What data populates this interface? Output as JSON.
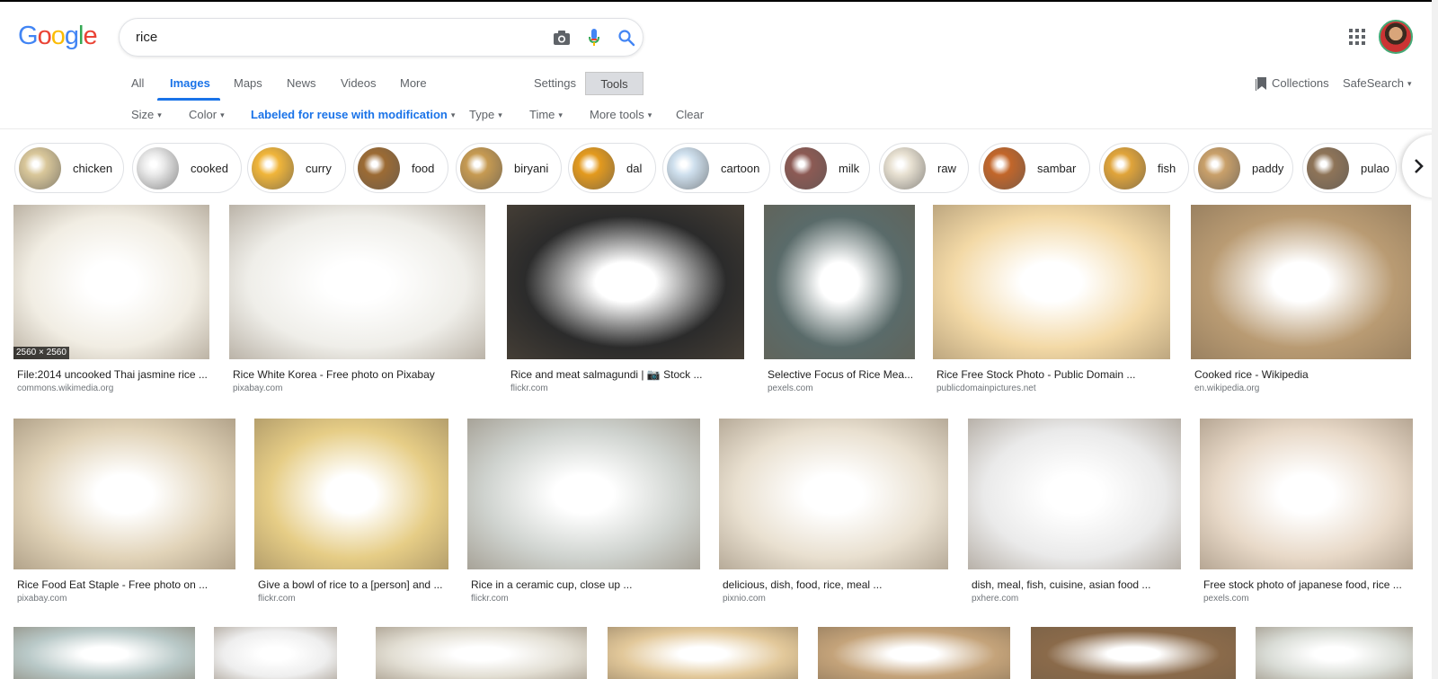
{
  "search": {
    "query": "rice"
  },
  "logo": {
    "letters": [
      "G",
      "o",
      "o",
      "g",
      "l",
      "e"
    ],
    "colors": [
      "#4285f4",
      "#ea4335",
      "#fbbc05",
      "#4285f4",
      "#34a853",
      "#ea4335"
    ]
  },
  "nav": {
    "tabs": [
      {
        "label": "All"
      },
      {
        "label": "Images"
      },
      {
        "label": "Maps"
      },
      {
        "label": "News"
      },
      {
        "label": "Videos"
      },
      {
        "label": "More"
      }
    ],
    "settings": "Settings",
    "tools": "Tools",
    "collections": "Collections",
    "safesearch": "SafeSearch"
  },
  "filters": {
    "size": "Size",
    "color": "Color",
    "usage": "Labeled for reuse with modification",
    "type": "Type",
    "time": "Time",
    "more_tools": "More tools",
    "clear": "Clear"
  },
  "chips": [
    {
      "label": "chicken",
      "color": "#d9c79a"
    },
    {
      "label": "cooked",
      "color": "#e9e9e9"
    },
    {
      "label": "curry",
      "color": "#f0b53a"
    },
    {
      "label": "food",
      "color": "#9c6b34"
    },
    {
      "label": "biryani",
      "color": "#c69a52"
    },
    {
      "label": "dal",
      "color": "#e39a1e"
    },
    {
      "label": "cartoon",
      "color": "#cfe0ee"
    },
    {
      "label": "milk",
      "color": "#8c5a54"
    },
    {
      "label": "raw",
      "color": "#e8e1d2"
    },
    {
      "label": "sambar",
      "color": "#c2662a"
    },
    {
      "label": "fish",
      "color": "#e0a43a"
    },
    {
      "label": "paddy",
      "color": "#c9a06a"
    },
    {
      "label": "pulao",
      "color": "#8e7458"
    }
  ],
  "results": [
    {
      "caption": "File:2014 uncooked Thai jasmine rice ...",
      "source": "commons.wikimedia.org",
      "dims": "2560 × 2560",
      "bg": "#f1ede3"
    },
    {
      "caption": "Rice White Korea - Free photo on Pixabay",
      "source": "pixabay.com",
      "bg": "#efeee9"
    },
    {
      "caption": "Rice and meat salmagundi | 📷 Stock ...",
      "source": "flickr.com",
      "bg": "#2b2b2b"
    },
    {
      "caption": "Selective Focus of Rice Mea...",
      "source": "pexels.com",
      "bg": "#5a6b6a"
    },
    {
      "caption": "Rice Free Stock Photo - Public Domain ...",
      "source": "publicdomainpictures.net",
      "bg": "#f3d9a6"
    },
    {
      "caption": "Cooked rice - Wikipedia",
      "source": "en.wikipedia.org",
      "bg": "#b99b73"
    },
    {
      "caption": "Rice Food Eat Staple - Free photo on ...",
      "source": "pixabay.com",
      "bg": "#e1d3b8"
    },
    {
      "caption": "Give a bowl of rice to a [person] and ...",
      "source": "flickr.com",
      "bg": "#e6cd86"
    },
    {
      "caption": "Rice in a ceramic cup, close up ...",
      "source": "flickr.com",
      "bg": "#cfd3cf"
    },
    {
      "caption": "delicious, dish, food, rice, meal ...",
      "source": "pixnio.com",
      "bg": "#e9e0d0"
    },
    {
      "caption": "dish, meal, fish, cuisine, asian food ...",
      "source": "pxhere.com",
      "bg": "#eaeaea"
    },
    {
      "caption": "Free stock photo of japanese food, rice ...",
      "source": "pexels.com",
      "bg": "#e8d9c8"
    },
    {
      "bg": "#b9c9c8"
    },
    {
      "bg": "#eeeeee"
    },
    {
      "bg": "#e2ded3"
    },
    {
      "bg": "#e2c89a"
    },
    {
      "bg": "#c4a37a"
    },
    {
      "bg": "#8a6a4a"
    },
    {
      "bg": "#d9dcd6"
    }
  ]
}
